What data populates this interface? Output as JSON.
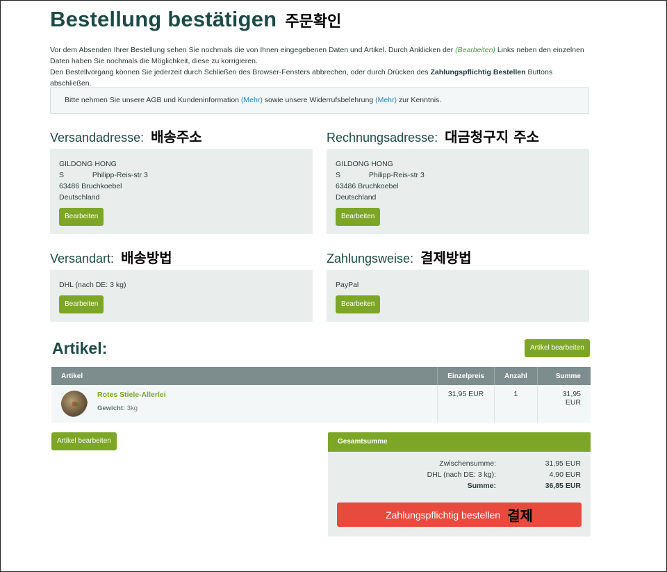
{
  "header": {
    "title": "Bestellung bestätigen",
    "title_annotation": "주문확인"
  },
  "intro": {
    "text_1": "Vor dem Absenden Ihrer Bestellung sehen Sie nochmals die von Ihnen eingegebenen Daten und Artikel. Durch Anklicken der ",
    "edit_link": "(Bearbeiten)",
    "text_2": " Links neben den einzelnen Daten haben Sie nochmals die Möglichkeit, diese zu korrigieren.",
    "text_3": "Den Bestellvorgang können Sie jederzeit durch Schließen des Browser-Fensters abbrechen, oder durch Drücken des ",
    "text_bold": "Zahlungspflichtig Bestellen",
    "text_4": " Buttons abschließen."
  },
  "notice": {
    "text_1": "Bitte nehmen Sie unsere AGB und Kundeninformation ",
    "more_1": "(Mehr)",
    "text_2": " sowie unsere Widerrufsbelehrung ",
    "more_2": "(Mehr)",
    "text_3": " zur Kenntnis."
  },
  "shipping_address": {
    "title": "Versandadresse:",
    "annotation": "배송주소",
    "lines": [
      "GILDONG HONG",
      "S              Philipp-Reis-str 3",
      "63486 Bruchkoebel",
      "Deutschland"
    ],
    "edit_label": "Bearbeiten"
  },
  "billing_address": {
    "title": "Rechnungsadresse:",
    "annotation": "대금청구지  주소",
    "lines": [
      "GILDONG HONG",
      "S              Philipp-Reis-str 3",
      "63486 Bruchkoebel",
      "Deutschland"
    ],
    "edit_label": "Bearbeiten"
  },
  "shipping_method": {
    "title": "Versandart:",
    "annotation": "배송방법",
    "value": "DHL (nach DE: 3 kg)",
    "edit_label": "Bearbeiten"
  },
  "payment_method": {
    "title": "Zahlungsweise:",
    "annotation": "결제방법",
    "value": "PayPal",
    "edit_label": "Bearbeiten"
  },
  "articles": {
    "title": "Artikel:",
    "edit_label": "Artikel bearbeiten",
    "columns": [
      "Artikel",
      "Einzelpreis",
      "Anzahl",
      "Summe"
    ],
    "rows": [
      {
        "name": "Rotes Stiele-Allerlei",
        "weight_label": "Gewicht:",
        "weight_value": "3kg",
        "unit_price": "31,95 EUR",
        "quantity": "1",
        "sum": "31,95 EUR"
      }
    ]
  },
  "totals": {
    "title": "Gesamtsumme",
    "subtotal_label": "Zwischensumme:",
    "subtotal_value": "31,95 EUR",
    "shipping_label": "DHL (nach DE: 3 kg):",
    "shipping_value": "4,90 EUR",
    "total_label": "Summe:",
    "total_value": "36,85 EUR",
    "order_button": "Zahlungspflichtig bestellen",
    "order_annotation": "결제"
  },
  "colors": {
    "heading": "#1d4a45",
    "accent_green": "#7da627",
    "order_red": "#e84a3e",
    "table_header": "#7d8d8d",
    "card_bg": "#e9eeed"
  }
}
